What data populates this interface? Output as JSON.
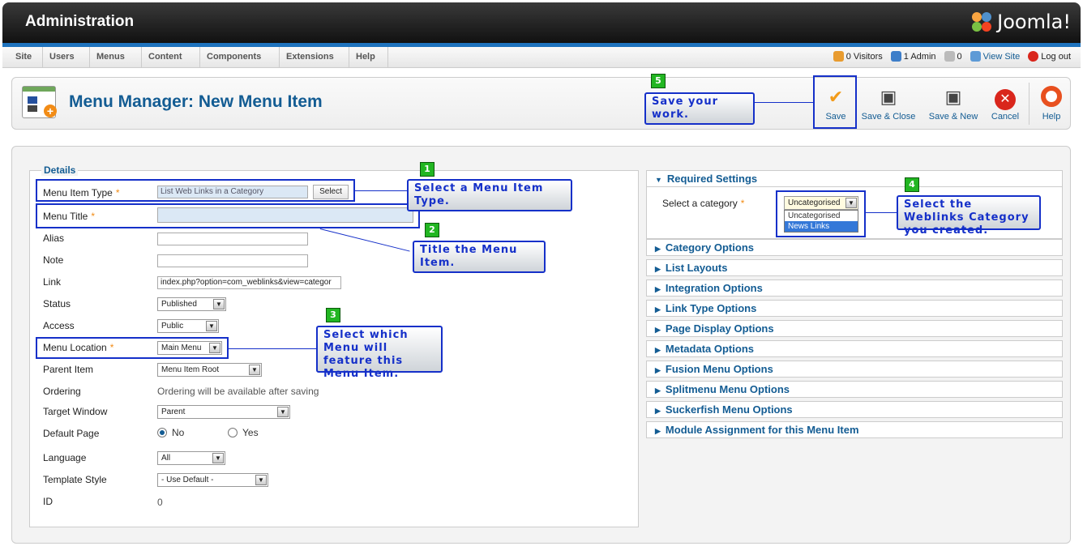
{
  "header": {
    "title": "Administration",
    "logo": "Joomla!"
  },
  "nav": [
    "Site",
    "Users",
    "Menus",
    "Content",
    "Components",
    "Extensions",
    "Help"
  ],
  "status": {
    "visitors": "0 Visitors",
    "admins": "1 Admin",
    "messages": "0",
    "view_site": "View Site",
    "logout": "Log out"
  },
  "toolbar": {
    "page_title": "Menu Manager: New Menu Item",
    "buttons": [
      "Save",
      "Save & Close",
      "Save & New",
      "Cancel",
      "Help"
    ]
  },
  "details": {
    "legend": "Details",
    "fields": {
      "menu_item_type": {
        "label": "Menu Item Type",
        "value": "List Web Links in a Category",
        "button": "Select"
      },
      "menu_title": {
        "label": "Menu Title",
        "value": ""
      },
      "alias": {
        "label": "Alias",
        "value": ""
      },
      "note": {
        "label": "Note",
        "value": ""
      },
      "link": {
        "label": "Link",
        "value": "index.php?option=com_weblinks&view=categor"
      },
      "status": {
        "label": "Status",
        "value": "Published"
      },
      "access": {
        "label": "Access",
        "value": "Public"
      },
      "menu_location": {
        "label": "Menu Location",
        "value": "Main Menu"
      },
      "parent_item": {
        "label": "Parent Item",
        "value": "Menu Item Root"
      },
      "ordering": {
        "label": "Ordering",
        "value": "Ordering will be available after saving"
      },
      "target_window": {
        "label": "Target Window",
        "value": "Parent"
      },
      "default_page": {
        "label": "Default Page",
        "no": "No",
        "yes": "Yes",
        "selected": "No"
      },
      "language": {
        "label": "Language",
        "value": "All"
      },
      "template_style": {
        "label": "Template Style",
        "value": "- Use Default -"
      },
      "id": {
        "label": "ID",
        "value": "0"
      }
    }
  },
  "required_settings": {
    "title": "Required Settings",
    "category_label": "Select a category",
    "category_value": "Uncategorised",
    "options": [
      "Uncategorised",
      "News Links"
    ],
    "highlighted_option": "News Links"
  },
  "panels": [
    "Category Options",
    "List Layouts",
    "Integration Options",
    "Link Type Options",
    "Page Display Options",
    "Metadata Options",
    "Fusion Menu Options",
    "Splitmenu Menu Options",
    "Suckerfish Menu Options",
    "Module Assignment for this Menu Item"
  ],
  "callouts": [
    {
      "num": "1",
      "text": "Select a Menu Item Type."
    },
    {
      "num": "2",
      "text": "Title the Menu Item."
    },
    {
      "num": "3",
      "text": "Select which Menu will feature this Menu Item."
    },
    {
      "num": "4",
      "text": "Select the Weblinks Category you created."
    },
    {
      "num": "5",
      "text": "Save your work."
    }
  ],
  "colors": {
    "accent": "#135c93",
    "callout": "#1530c9",
    "badge": "#22b622",
    "header_line": "#1e73be"
  }
}
